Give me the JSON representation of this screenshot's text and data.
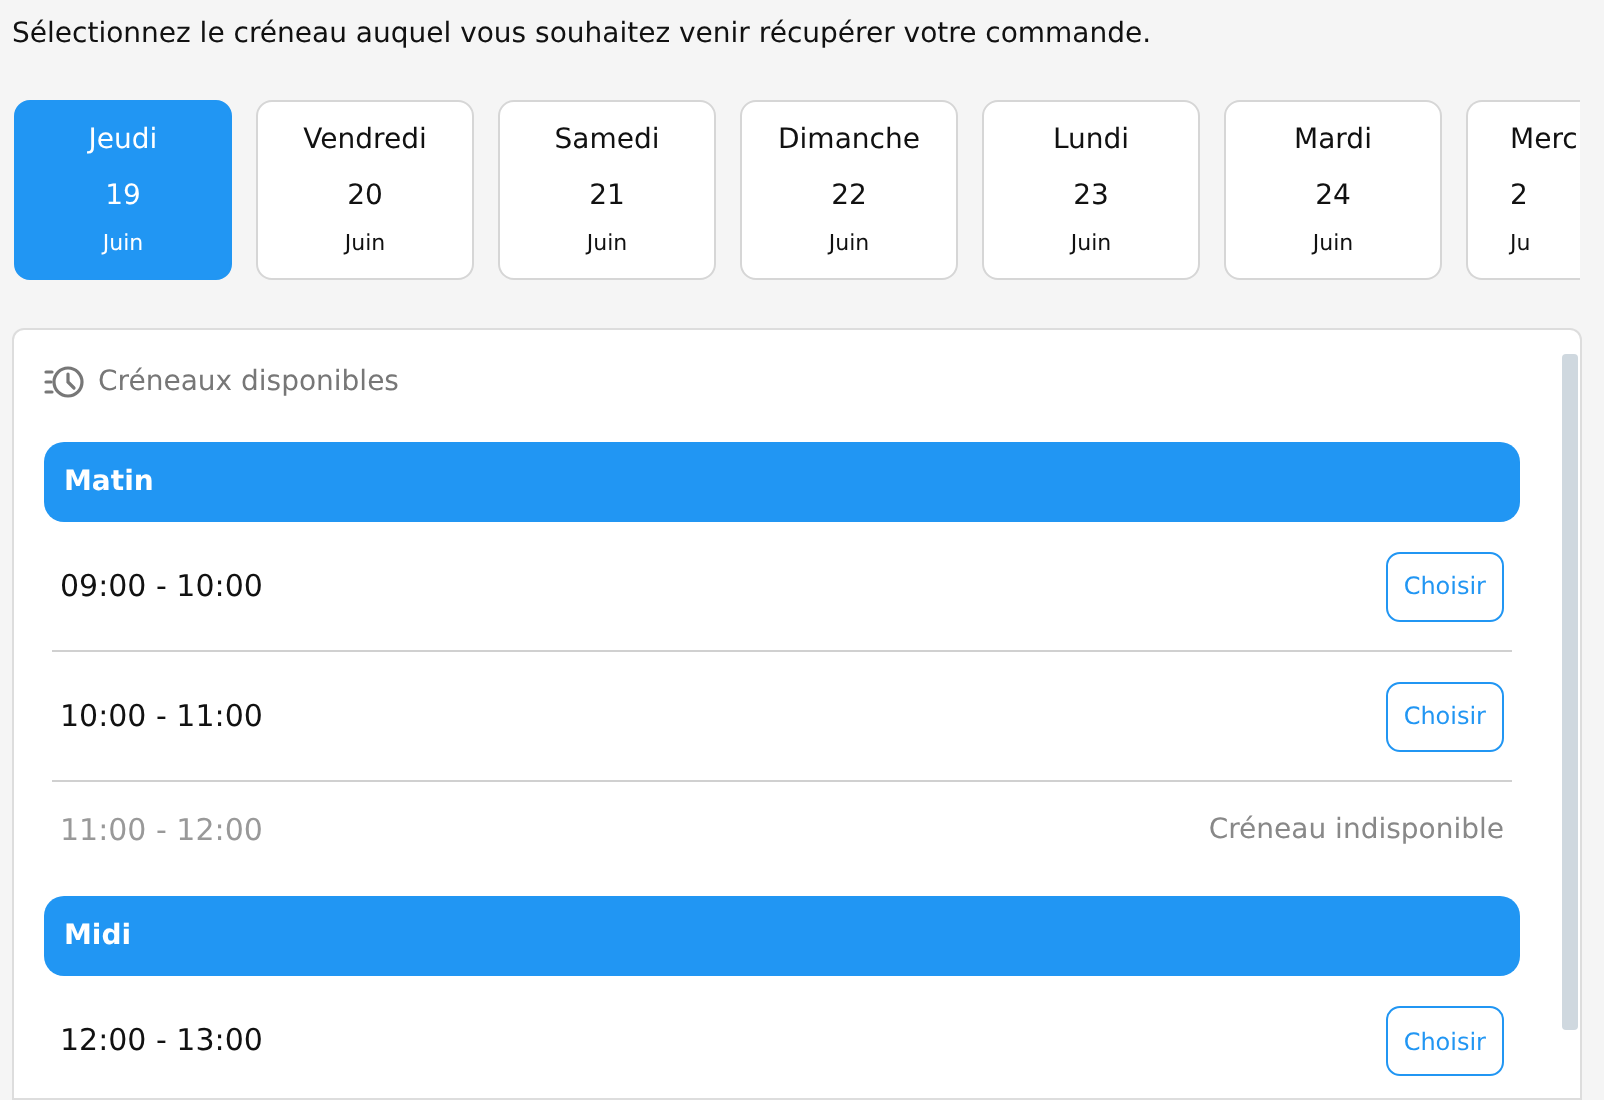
{
  "instruction": "Sélectionnez le créneau auquel vous souhaitez venir récupérer votre commande.",
  "days": [
    {
      "weekday": "Jeudi",
      "day": "19",
      "month": "Juin",
      "selected": true
    },
    {
      "weekday": "Vendredi",
      "day": "20",
      "month": "Juin",
      "selected": false
    },
    {
      "weekday": "Samedi",
      "day": "21",
      "month": "Juin",
      "selected": false
    },
    {
      "weekday": "Dimanche",
      "day": "22",
      "month": "Juin",
      "selected": false
    },
    {
      "weekday": "Lundi",
      "day": "23",
      "month": "Juin",
      "selected": false
    },
    {
      "weekday": "Mardi",
      "day": "24",
      "month": "Juin",
      "selected": false
    },
    {
      "weekday": "Merc",
      "day": "2",
      "month": "Ju",
      "selected": false,
      "cut": true
    }
  ],
  "slots_panel": {
    "title": "Créneaux disponibles",
    "items": [
      {
        "kind": "period",
        "label": "Matin"
      },
      {
        "kind": "slot",
        "time": "09:00 - 10:00",
        "available": true,
        "action": "Choisir"
      },
      {
        "kind": "slot",
        "time": "10:00 - 11:00",
        "available": true,
        "action": "Choisir"
      },
      {
        "kind": "slot",
        "time": "11:00 - 12:00",
        "available": false,
        "note": "Créneau indisponible"
      },
      {
        "kind": "period",
        "label": "Midi"
      },
      {
        "kind": "slot",
        "time": "12:00 - 13:00",
        "available": true,
        "action": "Choisir"
      }
    ]
  }
}
